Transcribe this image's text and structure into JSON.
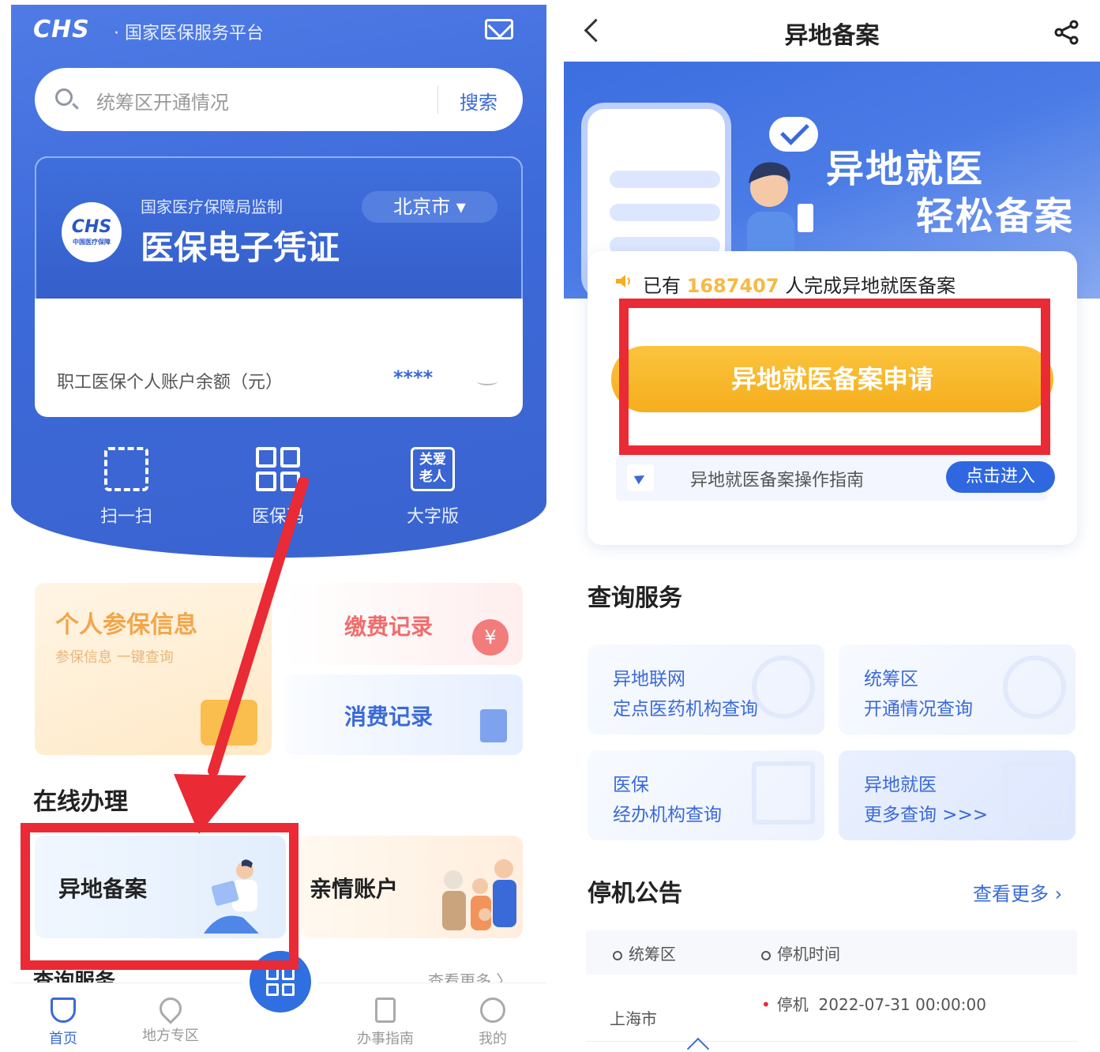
{
  "left": {
    "header": {
      "brand": "CHS",
      "brand_sub": "· 国家医保服务平台"
    },
    "search": {
      "placeholder": "统筹区开通情况",
      "button": "搜索"
    },
    "card": {
      "supervisor": "国家医疗保障局监制",
      "title": "医保电子凭证",
      "logo_text": "CHS",
      "logo_subtext": "中国医疗保障",
      "city": "北京市",
      "balance_label": "职工医保个人账户余额（元）",
      "balance_value": "****"
    },
    "quick_actions": [
      {
        "label": "扫一扫",
        "icon": "scan-icon"
      },
      {
        "label": "医保码",
        "icon": "qr-code-icon"
      },
      {
        "label": "大字版",
        "icon": "elder-care-icon",
        "icon_text_1": "关爱",
        "icon_text_2": "老人"
      }
    ],
    "tiles": {
      "personal_title": "个人参保信息",
      "personal_sub": "参保信息 一键查询",
      "payment": "缴费记录",
      "payment_icon_text": "¥",
      "spending": "消费记录"
    },
    "online_section": "在线办理",
    "online_tiles": {
      "remote": "异地备案",
      "family": "亲情账户"
    },
    "partial_section": "查询服务",
    "partial_more": "查看更多 〉",
    "tabbar": [
      {
        "label": "首页",
        "icon": "home-shield-icon",
        "active": true
      },
      {
        "label": "地方专区",
        "icon": "location-pin-icon",
        "active": false
      },
      {
        "label": "办事指南",
        "icon": "guide-doc-icon",
        "active": false
      },
      {
        "label": "我的",
        "icon": "profile-smile-icon",
        "active": false
      }
    ],
    "highlight_color": "#ea2a35"
  },
  "right": {
    "nav": {
      "title": "异地备案"
    },
    "banner": {
      "line1": "异地就医",
      "line2": "轻松备案"
    },
    "stats": {
      "prefix": "已有",
      "count": "1687407",
      "suffix": "人完成异地就医备案"
    },
    "apply_button": "异地就医备案申请",
    "guide": {
      "text": "异地就医备案操作指南",
      "button": "点击进入"
    },
    "query_section": "查询服务",
    "query_cards": [
      {
        "line1": "异地联网",
        "line2": "定点医药机构查询"
      },
      {
        "line1": "统筹区",
        "line2": "开通情况查询"
      },
      {
        "line1": "医保",
        "line2": "经办机构查询"
      },
      {
        "line1": "异地就医",
        "line2": "更多查询 >>>"
      }
    ],
    "notice_section": "停机公告",
    "notice_more": "查看更多 ›",
    "notice_table": {
      "col_region": "统筹区",
      "col_time": "停机时间",
      "rows": [
        {
          "region": "上海市",
          "status": "停机",
          "time": "2022-07-31 00:00:00"
        }
      ]
    }
  },
  "colors": {
    "primary": "#3a6ad8",
    "accent_orange": "#f5ae1e",
    "highlight_red": "#ea2a35"
  }
}
